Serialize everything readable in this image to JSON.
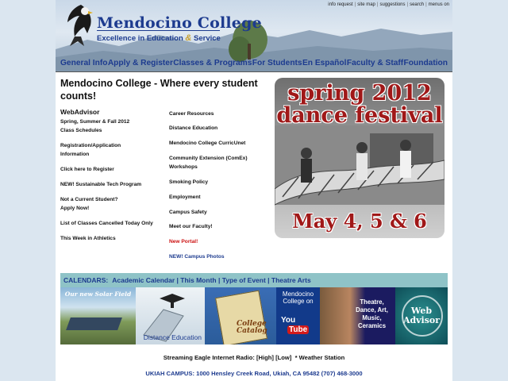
{
  "header": {
    "college_name": "Mendocino College",
    "tagline_pre": "Excellence in Education ",
    "tagline_amp": "&",
    "tagline_post": " Service",
    "util_links": [
      "info request",
      "site map",
      "suggestions",
      "search",
      "menus on"
    ]
  },
  "nav": [
    "General Info",
    "Apply & Register",
    "Classes & Programs",
    "For Students",
    "En Español",
    "Faculty & Staff",
    "Foundation"
  ],
  "main": {
    "headline": "Mendocino College - Where every student counts!",
    "left_col": {
      "webadvisor_title": "WebAdvisor",
      "webadvisor_sub1": "Spring, Summer & Fall 2012",
      "webadvisor_sub2": "Class Schedules",
      "reg1": "Registration/Application",
      "reg2": "Information",
      "click_register": "Click here to Register",
      "sustainable": "NEW! Sustainable Tech Program",
      "not_current1": "Not a Current Student?",
      "not_current2": "Apply Now!",
      "cancelled": "List of Classes Cancelled Today Only",
      "athletics": "This Week in Athletics"
    },
    "mid_col": {
      "career": "Career Resources",
      "distance": "Distance Education",
      "curricunet": "Mendocino College CurricUnet",
      "comex1": "Community Extension (ComEx)",
      "comex2": "Workshops",
      "smoking": "Smoking Policy",
      "employment": "Employment",
      "safety": "Campus Safety",
      "faculty": "Meet our Faculty!",
      "portal": "New Portal!",
      "photos": "NEW! Campus Photos"
    },
    "promo": {
      "line1": "spring 2012",
      "line2": "dance festival",
      "dates": "May 4, 5 & 6"
    }
  },
  "calendars": {
    "label": "CALENDARS:",
    "links": [
      "Academic Calendar",
      "This Month",
      "Type of Event",
      "Theatre Arts"
    ]
  },
  "banners": {
    "solar": "Our new Solar Field",
    "distance": "Distance Education",
    "catalog": "College Catalog",
    "youtube_text": "Mendocino College on",
    "youtube_you": "You",
    "youtube_tube": "Tube",
    "arts": "Theatre, Dance, Art, Music, Ceramics",
    "web_advisor": "Web Advisor"
  },
  "footer": {
    "radio_label": "Streaming Eagle Internet Radio: ",
    "radio_high": "[High]",
    "radio_low": "[Low]",
    "weather": "* Weather Station",
    "campus": "UKIAH CAMPUS: 1000 Hensley Creek Road, Ukiah, CA 95482 (707) 468-3000"
  }
}
